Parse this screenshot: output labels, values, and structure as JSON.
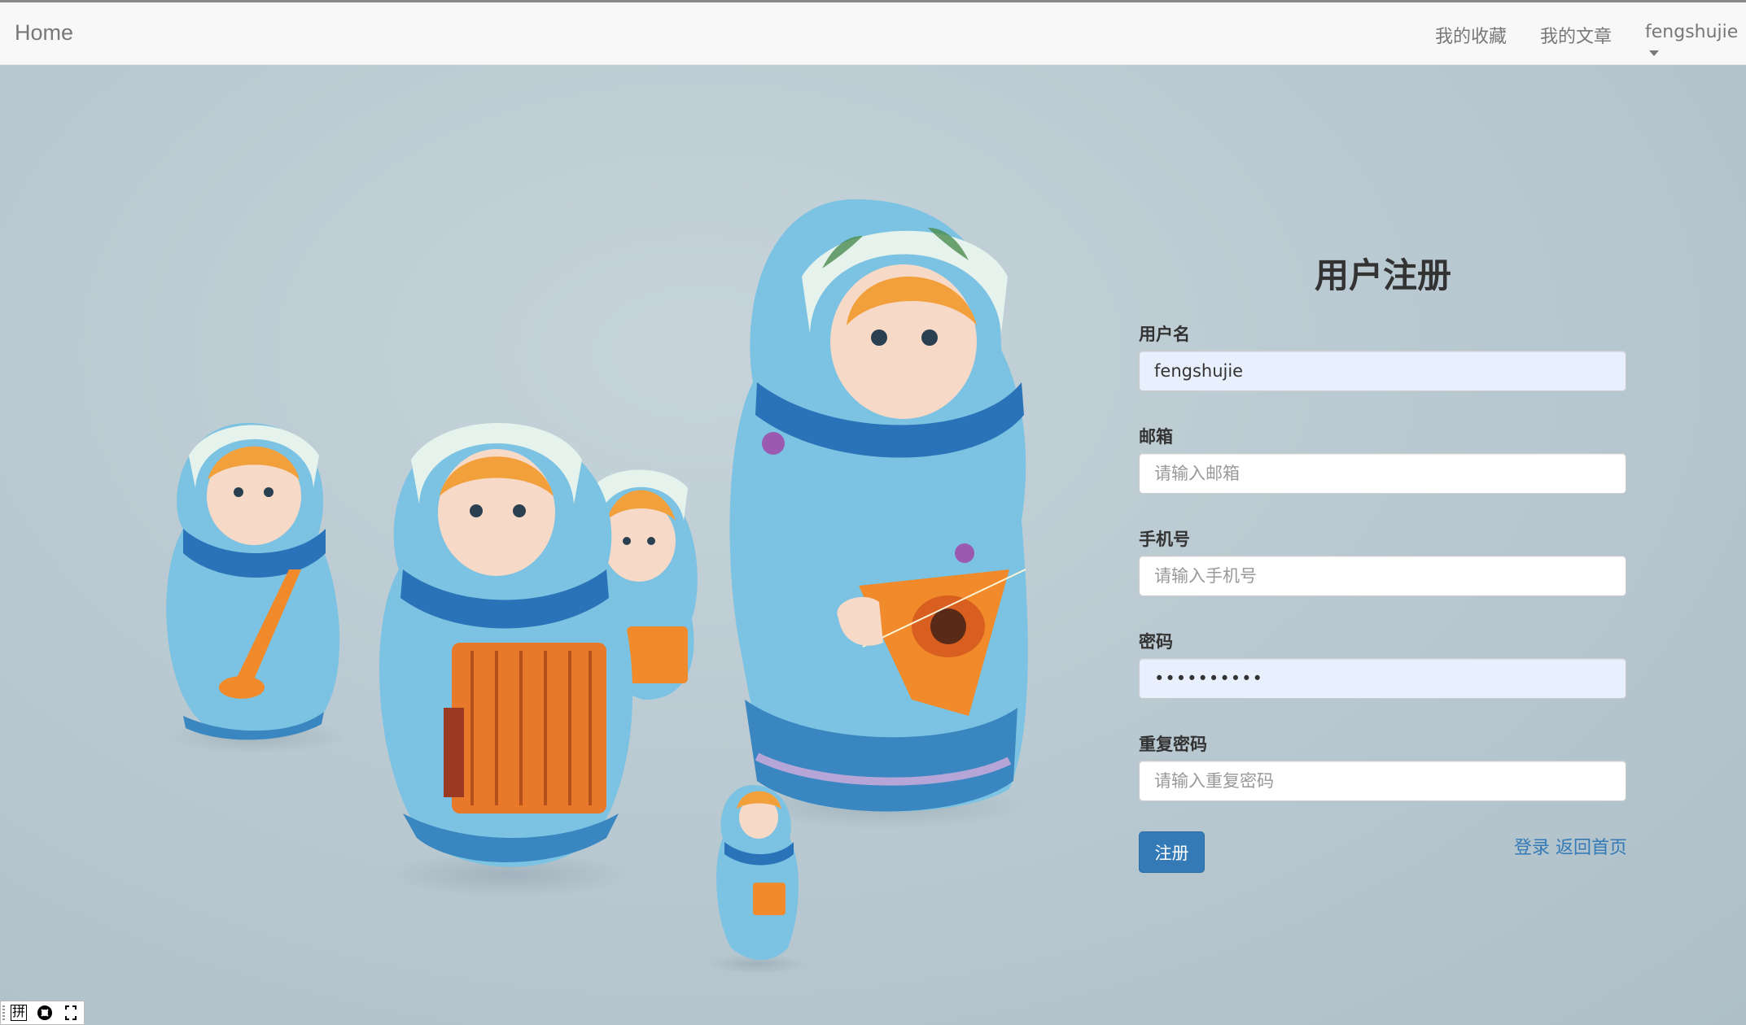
{
  "navbar": {
    "brand": "Home",
    "links": [
      "我的收藏",
      "我的文章"
    ],
    "user": "fengshujie"
  },
  "form": {
    "title": "用户注册",
    "fields": [
      {
        "label": "用户名",
        "value": "fengshujie",
        "placeholder": ""
      },
      {
        "label": "邮箱",
        "value": "",
        "placeholder": "请输入邮箱"
      },
      {
        "label": "手机号",
        "value": "",
        "placeholder": "请输入手机号"
      },
      {
        "label": "密码",
        "value": "••••••••••",
        "placeholder": ""
      },
      {
        "label": "重复密码",
        "value": "",
        "placeholder": "请输入重复密码"
      }
    ],
    "submit_label": "注册",
    "login_link": "登录",
    "home_link": "返回首页"
  },
  "ime": {
    "mode_char": "拼"
  },
  "colors": {
    "primary": "#337ab7",
    "navbar_bg": "#f8f8f8",
    "autofill_bg": "#e8f0fe",
    "background": "#c0ced6"
  }
}
